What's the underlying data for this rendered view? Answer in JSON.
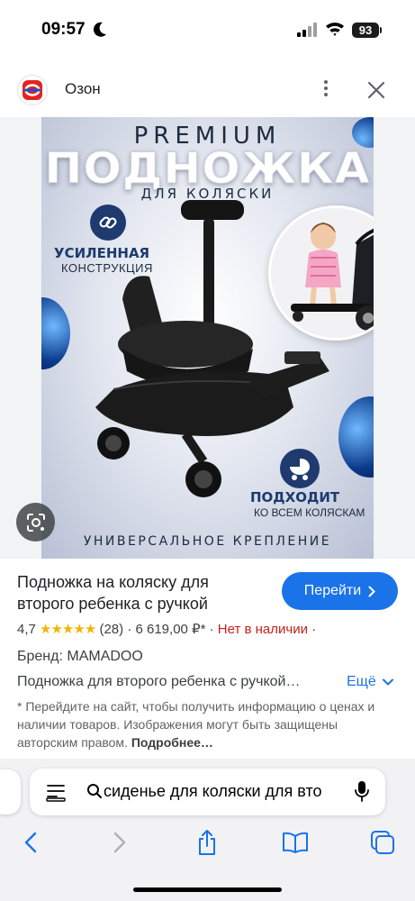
{
  "status_bar": {
    "time": "09:57",
    "battery": "93"
  },
  "source": {
    "name": "Озон",
    "logo_icon": "ozon-logo-icon"
  },
  "image": {
    "premium": "PREMIUM",
    "title": "ПОДНОЖКА",
    "subtitle": "ДЛЯ КОЛЯСКИ",
    "feature1_title": "УСИЛЕННАЯ",
    "feature1_sub": "КОНСТРУКЦИЯ",
    "feature2_title": "ПОДХОДИТ",
    "feature2_sub": "КО ВСЕМ КОЛЯСКАМ",
    "bottom_text": "УНИВЕРСАЛЬНОЕ КРЕПЛЕНИЕ"
  },
  "product": {
    "title": "Подножка на коляску для второго ребенка с ручкой",
    "goto_label": "Перейти",
    "rating": "4,7",
    "stars": "★★★★★",
    "reviews": "(28)",
    "dot1": "·",
    "price": "6 619,00 ₽*",
    "dot2": "·",
    "availability": "Нет в наличии",
    "dot3": "·",
    "brand": "Бренд: MAMADOO",
    "description": "Подножка для второго ребенка с ручкой…",
    "more_label": "Ещё",
    "note": "* Перейдите на сайт, чтобы получить информацию о ценах и наличии товаров. Изображения могут быть защищены авторским правом.",
    "note_link": "Подробнее…"
  },
  "browser": {
    "address_text": "сиденье для коляски для вто",
    "accent_color": "#1a73e8"
  }
}
